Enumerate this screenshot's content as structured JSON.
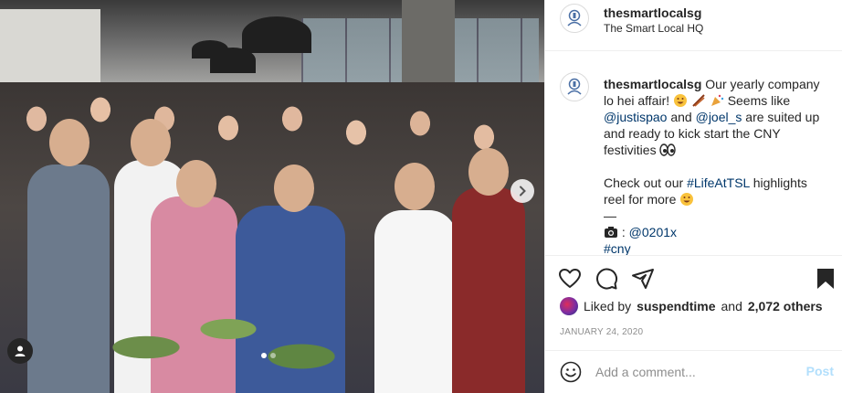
{
  "header": {
    "username": "thesmartlocalsg",
    "location": "The Smart Local HQ"
  },
  "caption": {
    "username": "thesmartlocalsg",
    "text_1": "Our yearly company lo hei affair!",
    "text_2": "Seems like",
    "mention_1": "@justispao",
    "text_3": "and",
    "mention_2": "@joel_s",
    "text_4": "are suited up and ready to kick start the CNY festivities",
    "text_5": "Check out our",
    "hashtag_1": "#LifeAtTSL",
    "text_6": "highlights reel for more",
    "divider": "—",
    "camera_mention": "@0201x",
    "hashtag_2": "#cny"
  },
  "likes": {
    "prefix": "Liked by",
    "liked_by": "suspendtime",
    "joiner": "and",
    "others": "2,072 others"
  },
  "date": "JANUARY 24, 2020",
  "add_comment": {
    "placeholder": "Add a comment...",
    "post_label": "Post"
  },
  "carousel": {
    "total": 2,
    "current": 1
  },
  "icons": [
    "like-heart-icon",
    "comment-icon",
    "share-icon",
    "save-bookmark-icon",
    "next-arrow-icon",
    "user-tag-icon",
    "emoji-smile-icon"
  ]
}
